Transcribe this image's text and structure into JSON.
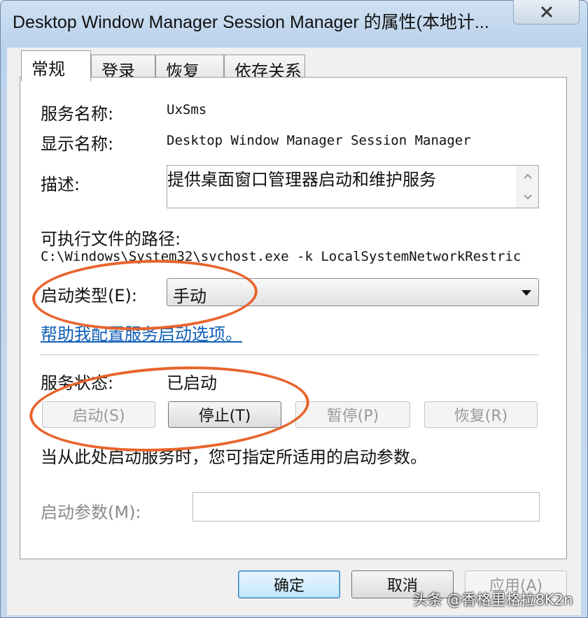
{
  "window": {
    "title": "Desktop Window Manager Session Manager 的属性(本地计..."
  },
  "tabs": [
    {
      "label": "常规"
    },
    {
      "label": "登录"
    },
    {
      "label": "恢复"
    },
    {
      "label": "依存关系"
    }
  ],
  "general": {
    "service_name_label": "服务名称:",
    "service_name_value": "UxSms",
    "display_name_label": "显示名称:",
    "display_name_value": "Desktop Window Manager Session Manager",
    "description_label": "描述:",
    "description_value": "提供桌面窗口管理器启动和维护服务",
    "exe_path_label": "可执行文件的路径:",
    "exe_path_value": "C:\\Windows\\System32\\svchost.exe -k LocalSystemNetworkRestric",
    "startup_type_label": "启动类型(E):",
    "startup_type_value": "手动",
    "help_link": "帮助我配置服务启动选项。",
    "status_label": "服务状态:",
    "status_value": "已启动",
    "buttons": {
      "start": "启动(S)",
      "stop": "停止(T)",
      "pause": "暂停(P)",
      "resume": "恢复(R)"
    },
    "hint": "当从此处启动服务时，您可指定所适用的启动参数。",
    "params_label": "启动参数(M):",
    "params_value": ""
  },
  "footer": {
    "ok": "确定",
    "cancel": "取消",
    "apply": "应用(A)"
  },
  "watermark": "头条 @香格里格拉8K2n",
  "colors": {
    "annotation": "#e8642c",
    "link": "#0f5fb7",
    "titlebar": "#bcd3ec"
  }
}
